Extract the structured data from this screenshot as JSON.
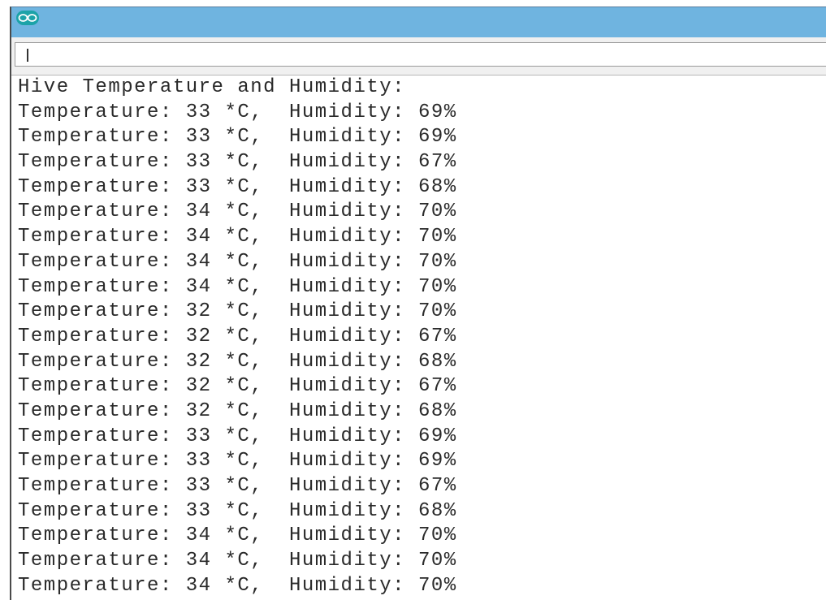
{
  "window": {
    "logo_icon": "arduino-infinity-icon",
    "accent_color": "#6fb4e0",
    "logo_color": "#1ca3a8"
  },
  "send_input": {
    "value": ""
  },
  "serial_output": {
    "lines": [
      "Hive Temperature and Humidity:",
      "Temperature: 33 *C,  Humidity: 69%",
      "Temperature: 33 *C,  Humidity: 69%",
      "Temperature: 33 *C,  Humidity: 67%",
      "Temperature: 33 *C,  Humidity: 68%",
      "Temperature: 34 *C,  Humidity: 70%",
      "Temperature: 34 *C,  Humidity: 70%",
      "Temperature: 34 *C,  Humidity: 70%",
      "Temperature: 34 *C,  Humidity: 70%",
      "Temperature: 32 *C,  Humidity: 70%",
      "Temperature: 32 *C,  Humidity: 67%",
      "Temperature: 32 *C,  Humidity: 68%",
      "Temperature: 32 *C,  Humidity: 67%",
      "Temperature: 32 *C,  Humidity: 68%",
      "Temperature: 33 *C,  Humidity: 69%",
      "Temperature: 33 *C,  Humidity: 69%",
      "Temperature: 33 *C,  Humidity: 67%",
      "Temperature: 33 *C,  Humidity: 68%",
      "Temperature: 34 *C,  Humidity: 70%",
      "Temperature: 34 *C,  Humidity: 70%",
      "Temperature: 34 *C,  Humidity: 70%"
    ]
  }
}
